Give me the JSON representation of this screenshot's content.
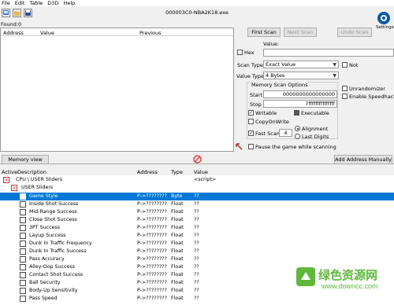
{
  "menu": [
    "File",
    "Edit",
    "Table",
    "D3D",
    "Help"
  ],
  "process_title": "000003C0-NBA2K18.exe",
  "found_label": "Found:0",
  "results_columns": [
    "Address",
    "Value",
    "Previous"
  ],
  "buttons": {
    "first_scan": "First Scan",
    "next_scan": "Next Scan",
    "undo_scan": "Undo Scan",
    "memory_view": "Memory view",
    "add_address": "Add Address Manually",
    "settings": "Settings"
  },
  "value_label": "Value:",
  "hex_label": "Hex",
  "scan_type_label": "Scan Type",
  "scan_type_value": "Exact Value",
  "value_type_label": "Value Type",
  "value_type_value": "4 Bytes",
  "not_label": "Not",
  "memory_scan_options": "Memory Scan Options",
  "start_label": "Start",
  "start_value": "0000000000000000",
  "stop_label": "Stop",
  "stop_value": "7fffffffffffffff",
  "writable_label": "Writable",
  "executable_label": "Executable",
  "copyonwrite_label": "CopyOnWrite",
  "fast_scan_label": "Fast Scan",
  "fast_scan_value": "4",
  "alignment_label": "Alignment",
  "last_digits_label": "Last Digits",
  "pause_label": "Pause the game while scanning",
  "unrandomizer_label": "Unrandomizer",
  "speedhack_label": "Enable Speedhack",
  "table_columns": [
    "Active",
    "Description",
    "Address",
    "Type",
    "Value"
  ],
  "groups": [
    {
      "desc": "CPU \\ USER Sliders",
      "value": "<script>"
    },
    {
      "desc": "USER Sliders"
    }
  ],
  "rows": [
    {
      "desc": "Game Style",
      "address": "P->????????",
      "type": "Byte",
      "value": "??",
      "selected": true
    },
    {
      "desc": "Inside Shot Success",
      "address": "P->????????",
      "type": "Float",
      "value": "??"
    },
    {
      "desc": "Mid-Range Success",
      "address": "P->????????",
      "type": "Float",
      "value": "??"
    },
    {
      "desc": "Close Shot Success",
      "address": "P->????????",
      "type": "Float",
      "value": "??"
    },
    {
      "desc": "3PT Success",
      "address": "P->????????",
      "type": "Float",
      "value": "??"
    },
    {
      "desc": "Layup Success",
      "address": "P->????????",
      "type": "Float",
      "value": "??"
    },
    {
      "desc": "Dunk In Traffic Frequency",
      "address": "P->????????",
      "type": "Float",
      "value": "??"
    },
    {
      "desc": "Dunk In Traffic Success",
      "address": "P->????????",
      "type": "Float",
      "value": "??"
    },
    {
      "desc": "Pass Accuracy",
      "address": "P->????????",
      "type": "Float",
      "value": "??"
    },
    {
      "desc": "Alley-Oop Success",
      "address": "P->????????",
      "type": "Float",
      "value": "??"
    },
    {
      "desc": "Contact Shot Success",
      "address": "P->????????",
      "type": "Float",
      "value": "??"
    },
    {
      "desc": "Ball Security",
      "address": "P->????????",
      "type": "Float",
      "value": "??"
    },
    {
      "desc": "Body-Up Sensitivity",
      "address": "P->????????",
      "type": "Float",
      "value": "??"
    },
    {
      "desc": "Pass Speed",
      "address": "P->????????",
      "type": "Float",
      "value": "??"
    }
  ],
  "watermark": {
    "cn": "绿色资源网",
    "url": "www.downcc.com"
  },
  "colors": {
    "selection": "#0078d7",
    "watermark_green": "#5fb83c",
    "ce_blue": "#0a58a8"
  },
  "icons": [
    "open-process-icon",
    "open-file-icon",
    "save-icon",
    "settings-logo-icon",
    "pointer-arrow-icon",
    "stop-icon"
  ]
}
